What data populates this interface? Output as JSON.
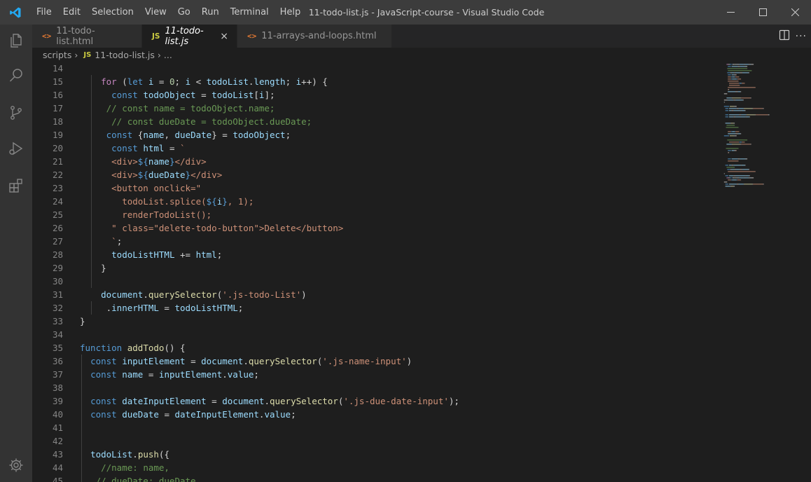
{
  "title_bar": {
    "menus": [
      "File",
      "Edit",
      "Selection",
      "View",
      "Go",
      "Run",
      "Terminal",
      "Help"
    ],
    "window_title": "11-todo-list.js - JavaScript-course - Visual Studio Code"
  },
  "tabs": [
    {
      "label": "11-todo-list.html",
      "icon": "<>",
      "type": "html",
      "active": false,
      "italic": false
    },
    {
      "label": "11-todo-list.js",
      "icon": "JS",
      "type": "js",
      "active": true,
      "italic": true,
      "close": "×"
    },
    {
      "label": "11-arrays-and-loops.html",
      "icon": "<>",
      "type": "html",
      "active": false,
      "italic": false
    }
  ],
  "editor_actions": {
    "more": "..."
  },
  "breadcrumb": {
    "folder": "scripts",
    "file_icon": "JS",
    "file": "11-todo-list.js",
    "symbol": "..."
  },
  "colors": {
    "keyword": "#569cd6",
    "control": "#c586c0",
    "variable": "#9cdcfe",
    "function": "#dcdcaa",
    "string": "#ce9178",
    "comment": "#6a9955",
    "number": "#b5cea8",
    "tag": "#569cd6",
    "text": "#d4d4d4",
    "accent": "#007acc"
  },
  "code_lines": [
    {
      "n": "14",
      "t": []
    },
    {
      "n": "15",
      "t": [
        [
          "    ",
          "d"
        ],
        [
          "for",
          "k"
        ],
        [
          " (",
          "d"
        ],
        [
          "let",
          "b"
        ],
        [
          " ",
          "d"
        ],
        [
          "i",
          "v"
        ],
        [
          " = ",
          "d"
        ],
        [
          "0",
          "n"
        ],
        [
          "; ",
          "d"
        ],
        [
          "i",
          "v"
        ],
        [
          " < ",
          "d"
        ],
        [
          "todoList",
          "v"
        ],
        [
          ".",
          "d"
        ],
        [
          "length",
          "v"
        ],
        [
          "; ",
          "d"
        ],
        [
          "i",
          "v"
        ],
        [
          "++) {",
          "d"
        ]
      ]
    },
    {
      "n": "16",
      "t": [
        [
          "      ",
          "d"
        ],
        [
          "const",
          "b"
        ],
        [
          " ",
          "d"
        ],
        [
          "todoObject",
          "v"
        ],
        [
          " = ",
          "d"
        ],
        [
          "todoList",
          "v"
        ],
        [
          "[",
          "d"
        ],
        [
          "i",
          "v"
        ],
        [
          "];",
          "d"
        ]
      ]
    },
    {
      "n": "17",
      "t": [
        [
          "     ",
          "d"
        ],
        [
          "// const name = todoObject.name;",
          "c"
        ]
      ]
    },
    {
      "n": "18",
      "t": [
        [
          "      ",
          "d"
        ],
        [
          "// const dueDate = todoObject.dueDate;",
          "c"
        ]
      ]
    },
    {
      "n": "19",
      "t": [
        [
          "     ",
          "d"
        ],
        [
          "const",
          "b"
        ],
        [
          " {",
          "d"
        ],
        [
          "name",
          "v"
        ],
        [
          ", ",
          "d"
        ],
        [
          "dueDate",
          "v"
        ],
        [
          "} = ",
          "d"
        ],
        [
          "todoObject",
          "v"
        ],
        [
          ";",
          "d"
        ]
      ]
    },
    {
      "n": "20",
      "t": [
        [
          "      ",
          "d"
        ],
        [
          "const",
          "b"
        ],
        [
          " ",
          "d"
        ],
        [
          "html",
          "v"
        ],
        [
          " = ",
          "d"
        ],
        [
          "`",
          "s"
        ]
      ]
    },
    {
      "n": "21",
      "t": [
        [
          "      ",
          "d"
        ],
        [
          "<div>",
          "s"
        ],
        [
          "${",
          "b"
        ],
        [
          "name",
          "v"
        ],
        [
          "}",
          "b"
        ],
        [
          "</div>",
          "s"
        ]
      ]
    },
    {
      "n": "22",
      "t": [
        [
          "      ",
          "d"
        ],
        [
          "<div>",
          "s"
        ],
        [
          "${",
          "b"
        ],
        [
          "dueDate",
          "v"
        ],
        [
          "}",
          "b"
        ],
        [
          "</div>",
          "s"
        ]
      ]
    },
    {
      "n": "23",
      "t": [
        [
          "      ",
          "d"
        ],
        [
          "<button onclick=\"",
          "s"
        ]
      ]
    },
    {
      "n": "24",
      "t": [
        [
          "        ",
          "d"
        ],
        [
          "todoList.splice(",
          "s"
        ],
        [
          "${",
          "b"
        ],
        [
          "i",
          "v"
        ],
        [
          "}",
          "b"
        ],
        [
          ", 1);",
          "s"
        ]
      ]
    },
    {
      "n": "25",
      "t": [
        [
          "        ",
          "d"
        ],
        [
          "renderTodoList();",
          "s"
        ]
      ]
    },
    {
      "n": "26",
      "t": [
        [
          "      ",
          "d"
        ],
        [
          "\" class=\"delete-todo-button\">Delete</button>",
          "s"
        ]
      ]
    },
    {
      "n": "27",
      "t": [
        [
          "      ",
          "d"
        ],
        [
          "`",
          "s"
        ],
        [
          ";",
          "d"
        ]
      ]
    },
    {
      "n": "28",
      "t": [
        [
          "      ",
          "d"
        ],
        [
          "todoListHTML",
          "v"
        ],
        [
          " += ",
          "d"
        ],
        [
          "html",
          "v"
        ],
        [
          ";",
          "d"
        ]
      ]
    },
    {
      "n": "29",
      "t": [
        [
          "    }",
          "d"
        ]
      ]
    },
    {
      "n": "30",
      "t": []
    },
    {
      "n": "31",
      "t": [
        [
          "    ",
          "d"
        ],
        [
          "document",
          "v"
        ],
        [
          ".",
          "d"
        ],
        [
          "querySelector",
          "f"
        ],
        [
          "(",
          "d"
        ],
        [
          "'.js-todo-List'",
          "s"
        ],
        [
          ")",
          "d"
        ]
      ]
    },
    {
      "n": "32",
      "t": [
        [
          "     .",
          "d"
        ],
        [
          "innerHTML",
          "v"
        ],
        [
          " = ",
          "d"
        ],
        [
          "todoListHTML",
          "v"
        ],
        [
          ";",
          "d"
        ]
      ]
    },
    {
      "n": "33",
      "t": [
        [
          "}",
          "d"
        ]
      ]
    },
    {
      "n": "34",
      "t": []
    },
    {
      "n": "35",
      "t": [
        [
          "function",
          "b"
        ],
        [
          " ",
          "d"
        ],
        [
          "addTodo",
          "f"
        ],
        [
          "() {",
          "d"
        ]
      ]
    },
    {
      "n": "36",
      "t": [
        [
          "  ",
          "d"
        ],
        [
          "const",
          "b"
        ],
        [
          " ",
          "d"
        ],
        [
          "inputElement",
          "v"
        ],
        [
          " = ",
          "d"
        ],
        [
          "document",
          "v"
        ],
        [
          ".",
          "d"
        ],
        [
          "querySelector",
          "f"
        ],
        [
          "(",
          "d"
        ],
        [
          "'.js-name-input'",
          "s"
        ],
        [
          ")",
          "d"
        ]
      ]
    },
    {
      "n": "37",
      "t": [
        [
          "  ",
          "d"
        ],
        [
          "const",
          "b"
        ],
        [
          " ",
          "d"
        ],
        [
          "name",
          "v"
        ],
        [
          " = ",
          "d"
        ],
        [
          "inputElement",
          "v"
        ],
        [
          ".",
          "d"
        ],
        [
          "value",
          "v"
        ],
        [
          ";",
          "d"
        ]
      ]
    },
    {
      "n": "38",
      "t": []
    },
    {
      "n": "39",
      "t": [
        [
          "  ",
          "d"
        ],
        [
          "const",
          "b"
        ],
        [
          " ",
          "d"
        ],
        [
          "dateInputElement",
          "v"
        ],
        [
          " = ",
          "d"
        ],
        [
          "document",
          "v"
        ],
        [
          ".",
          "d"
        ],
        [
          "querySelector",
          "f"
        ],
        [
          "(",
          "d"
        ],
        [
          "'.js-due-date-input'",
          "s"
        ],
        [
          ");",
          "d"
        ]
      ]
    },
    {
      "n": "40",
      "t": [
        [
          "  ",
          "d"
        ],
        [
          "const",
          "b"
        ],
        [
          " ",
          "d"
        ],
        [
          "dueDate",
          "v"
        ],
        [
          " = ",
          "d"
        ],
        [
          "dateInputElement",
          "v"
        ],
        [
          ".",
          "d"
        ],
        [
          "value",
          "v"
        ],
        [
          ";",
          "d"
        ]
      ]
    },
    {
      "n": "41",
      "t": []
    },
    {
      "n": "42",
      "t": []
    },
    {
      "n": "43",
      "t": [
        [
          "  ",
          "d"
        ],
        [
          "todoList",
          "v"
        ],
        [
          ".",
          "d"
        ],
        [
          "push",
          "f"
        ],
        [
          "({",
          "d"
        ]
      ]
    },
    {
      "n": "44",
      "t": [
        [
          "    ",
          "d"
        ],
        [
          "//name: name,",
          "c"
        ]
      ]
    },
    {
      "n": "45",
      "t": [
        [
          "   ",
          "d"
        ],
        [
          "// dueDate: dueDate,",
          "c"
        ]
      ]
    }
  ]
}
